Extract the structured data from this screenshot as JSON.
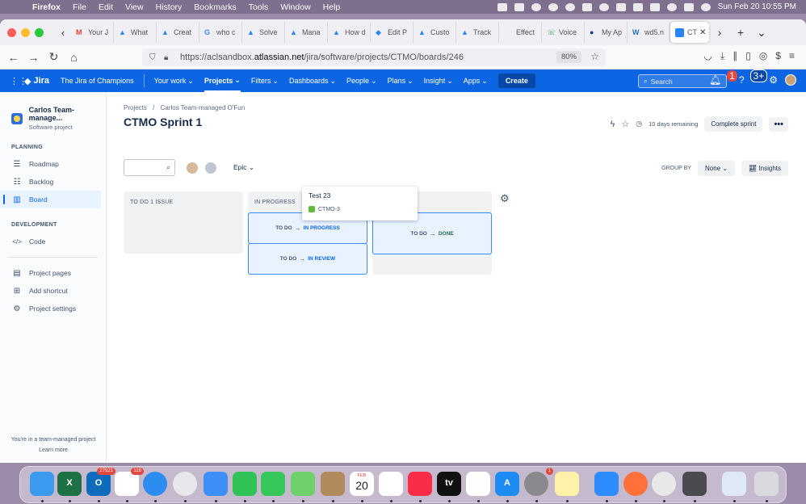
{
  "menubar": {
    "app": "Firefox",
    "items": [
      "File",
      "Edit",
      "View",
      "History",
      "Bookmarks",
      "Tools",
      "Window",
      "Help"
    ],
    "clock": "Sun Feb 20  10:55 PM"
  },
  "tabs": [
    {
      "label": "Your J",
      "color": "#ea4335",
      "glyph": "M"
    },
    {
      "label": "What",
      "color": "#2684ff",
      "glyph": "▲"
    },
    {
      "label": "Creat",
      "color": "#2684ff",
      "glyph": "▲"
    },
    {
      "label": "who c",
      "color": "#4285f4",
      "glyph": "G"
    },
    {
      "label": "Solve",
      "color": "#2684ff",
      "glyph": "▲"
    },
    {
      "label": "Mana",
      "color": "#2684ff",
      "glyph": "▲"
    },
    {
      "label": "How d",
      "color": "#2684ff",
      "glyph": "▲"
    },
    {
      "label": "Edit P",
      "color": "#2684ff",
      "glyph": "◆"
    },
    {
      "label": "Custo",
      "color": "#2684ff",
      "glyph": "▲"
    },
    {
      "label": "Track",
      "color": "#2684ff",
      "glyph": "▲"
    },
    {
      "label": "Effect",
      "color": "#ffffff",
      "glyph": ""
    },
    {
      "label": "Voice",
      "color": "#34a853",
      "glyph": "☏"
    },
    {
      "label": "My Ap",
      "color": "#1a3c8c",
      "glyph": "●"
    },
    {
      "label": "wd5.n",
      "color": "#1e73be",
      "glyph": "W"
    }
  ],
  "active_tab": {
    "label": "CT",
    "close": "✕"
  },
  "url": {
    "prefix": "https://aclsandbox.",
    "host": "atlassian.net",
    "path": "/jira/software/projects/CTMO/boards/246",
    "zoom": "80%"
  },
  "jira": {
    "logo": "Jira",
    "site": "The Jira of Champions",
    "menus": [
      "Your work",
      "Projects",
      "Filters",
      "Dashboards",
      "People",
      "Plans",
      "Insight",
      "Apps"
    ],
    "create": "Create",
    "search_placeholder": "Search",
    "notif_count": "1",
    "help_count": "3+"
  },
  "sidebar": {
    "project_name": "Carlos Team-manage...",
    "project_type": "Software project",
    "planning_header": "PLANNING",
    "planning": [
      {
        "label": "Roadmap",
        "icon": "roadmap-icon",
        "glyph": "☰"
      },
      {
        "label": "Backlog",
        "icon": "backlog-icon",
        "glyph": "☷"
      },
      {
        "label": "Board",
        "icon": "board-icon",
        "glyph": "▥",
        "active": true
      }
    ],
    "development_header": "DEVELOPMENT",
    "development": [
      {
        "label": "Code",
        "icon": "code-icon",
        "glyph": "</>"
      }
    ],
    "other": [
      {
        "label": "Project pages",
        "icon": "pages-icon",
        "glyph": "▤"
      },
      {
        "label": "Add shortcut",
        "icon": "shortcut-icon",
        "glyph": "⊞"
      },
      {
        "label": "Project settings",
        "icon": "settings-icon",
        "glyph": "⚙"
      }
    ],
    "footer": "You're in a team-managed project",
    "learn_more": "Learn more"
  },
  "board": {
    "breadcrumb": [
      "Projects",
      "Carlos Team-managed O'Fun"
    ],
    "breadcrumb_sep": "/",
    "title": "CTMO Sprint 1",
    "remaining": "10 days remaining",
    "complete_sprint": "Complete sprint",
    "more": "•••",
    "epic_filter": "Epic",
    "group_by_label": "GROUP BY",
    "group_by_value": "None",
    "insights": "Insights",
    "columns": [
      {
        "header": "TO DO 1 ISSUE"
      },
      {
        "header": "IN PROGRESS"
      },
      {
        "header": ""
      }
    ],
    "dropzones": [
      {
        "from": "TO DO",
        "to": "IN PROGRESS"
      },
      {
        "from": "TO DO",
        "to": "IN REVIEW"
      },
      {
        "from": "TO DO",
        "to": "DONE"
      }
    ],
    "card": {
      "title": "Test 23",
      "key": "CTMO-3"
    }
  },
  "dock": {
    "apps": [
      {
        "name": "finder",
        "color": "#3a9bf0"
      },
      {
        "name": "excel",
        "color": "#1e7145",
        "label": "X"
      },
      {
        "name": "outlook",
        "color": "#0f6cbd",
        "label": "O",
        "badge": "27521"
      },
      {
        "name": "slack",
        "color": "#ffffff",
        "badge": "116"
      },
      {
        "name": "safari",
        "color": "#2d8cf0"
      },
      {
        "name": "wifi-utility",
        "color": "#e8e8ec"
      },
      {
        "name": "mail",
        "color": "#3d8ff5"
      },
      {
        "name": "facetime",
        "color": "#2fc254"
      },
      {
        "name": "messages",
        "color": "#35c759"
      },
      {
        "name": "maps",
        "color": "#6fcf6a"
      },
      {
        "name": "contacts",
        "color": "#b08a5c"
      },
      {
        "name": "calendar",
        "color": "#ffffff",
        "month": "FEB",
        "day": "20"
      },
      {
        "name": "reminders",
        "color": "#ffffff"
      },
      {
        "name": "music",
        "color": "#fa2d48"
      },
      {
        "name": "tv",
        "color": "#111111",
        "label": "tv"
      },
      {
        "name": "news",
        "color": "#ffffff"
      },
      {
        "name": "app-store",
        "color": "#1e8cf5",
        "label": "A"
      },
      {
        "name": "system-preferences",
        "color": "#8a8a8e",
        "badge": "1"
      },
      {
        "name": "notes",
        "color": "#fff2a8"
      },
      {
        "name": "zoom",
        "color": "#2d8cff"
      },
      {
        "name": "firefox",
        "color": "#ff7139"
      },
      {
        "name": "chrome",
        "color": "#e8e8e8"
      },
      {
        "name": "printer",
        "color": "#4a4a4f"
      },
      {
        "name": "preview-window",
        "color": "#dfe8f5"
      },
      {
        "name": "trash",
        "color": "#d9dadf"
      }
    ]
  },
  "colors": {
    "jira_blue": "#0c66e4",
    "dropzone_border": "#388bff",
    "done_green": "#216e4e"
  }
}
